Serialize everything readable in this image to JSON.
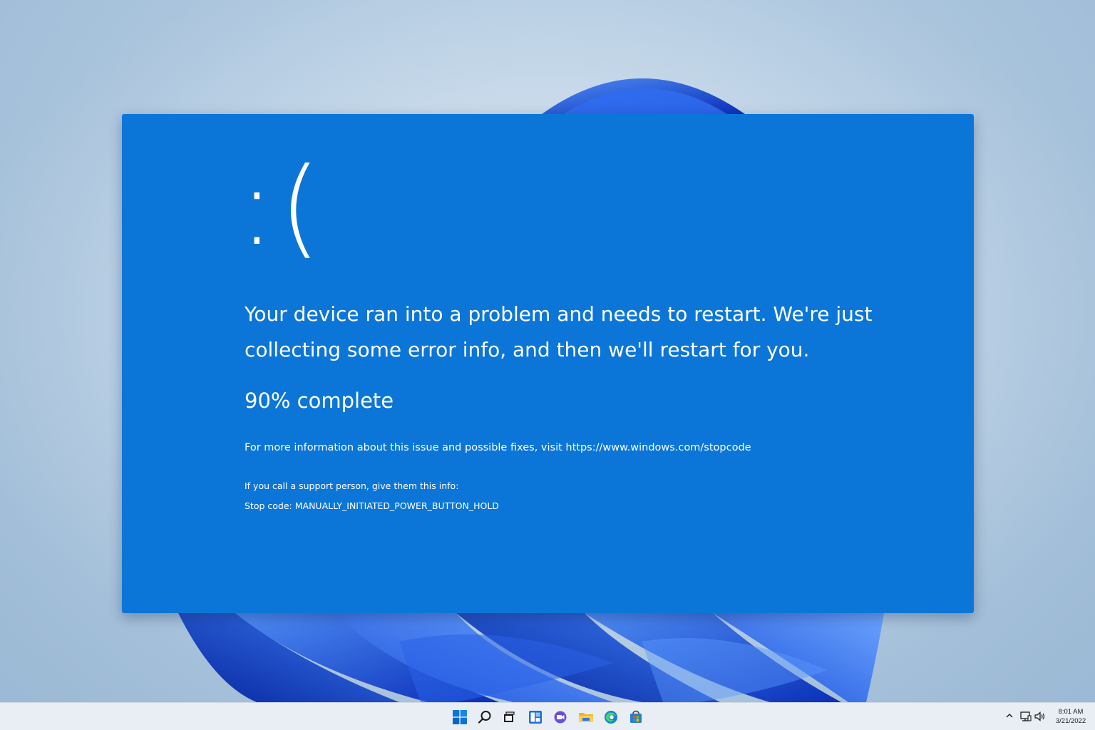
{
  "bsod": {
    "sad_face": ":(",
    "message": "Your device ran into a problem and needs to restart. We're just collecting some error info, and then we'll restart for you.",
    "progress_percent": 90,
    "progress_text": "90% complete",
    "more_info_prefix": "For more information about this issue and possible fixes, visit ",
    "more_info_url": "https://www.windows.com/stopcode",
    "support_text": "If you call a support person, give them this info:",
    "stop_code_label": "Stop code: ",
    "stop_code": "MANUALLY_INITIATED_POWER_BUTTON_HOLD",
    "background_color": "#0b76d8"
  },
  "taskbar": {
    "apps": [
      {
        "name": "start",
        "icon": "windows-logo-icon"
      },
      {
        "name": "search",
        "icon": "search-icon"
      },
      {
        "name": "task-view",
        "icon": "task-view-icon"
      },
      {
        "name": "widgets",
        "icon": "widgets-icon"
      },
      {
        "name": "chat",
        "icon": "chat-icon"
      },
      {
        "name": "file-explorer",
        "icon": "folder-icon"
      },
      {
        "name": "edge",
        "icon": "edge-browser-icon"
      },
      {
        "name": "store",
        "icon": "store-icon"
      }
    ],
    "tray": {
      "chevron_icon": "chevron-up-icon",
      "network_icon": "network-icon",
      "volume_icon": "volume-icon",
      "time": "8:01 AM",
      "date": "3/21/2022"
    },
    "accent_color": "#0067c0"
  }
}
